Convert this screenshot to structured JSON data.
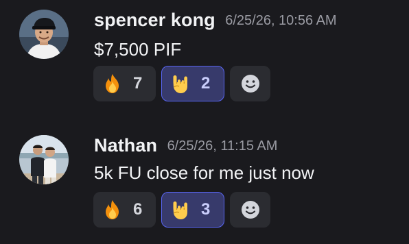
{
  "messages": [
    {
      "author": "spencer kong",
      "timestamp": "6/25/26, 10:56 AM",
      "content": "$7,500 PIF",
      "avatar": "avatar-photo-man-cap",
      "reactions": [
        {
          "emoji": "fire-emoji",
          "count": "7",
          "selected": false
        },
        {
          "emoji": "rock-on-hand-emoji",
          "count": "2",
          "selected": true
        }
      ]
    },
    {
      "author": "Nathan",
      "timestamp": "6/25/26, 11:15 AM",
      "content": "5k FU close for me just now",
      "avatar": "avatar-photo-two-people",
      "reactions": [
        {
          "emoji": "fire-emoji",
          "count": "6",
          "selected": false
        },
        {
          "emoji": "rock-on-hand-emoji",
          "count": "3",
          "selected": true
        }
      ]
    }
  ],
  "add_reaction_icon": "smiley-add-reaction-icon",
  "colors": {
    "background": "#1a1a1e",
    "reaction_bg": "#2b2c31",
    "reaction_selected_bg": "#373a6b",
    "reaction_selected_border": "#5865f2",
    "username": "#f2f3f5",
    "timestamp": "#9a9ba3"
  }
}
